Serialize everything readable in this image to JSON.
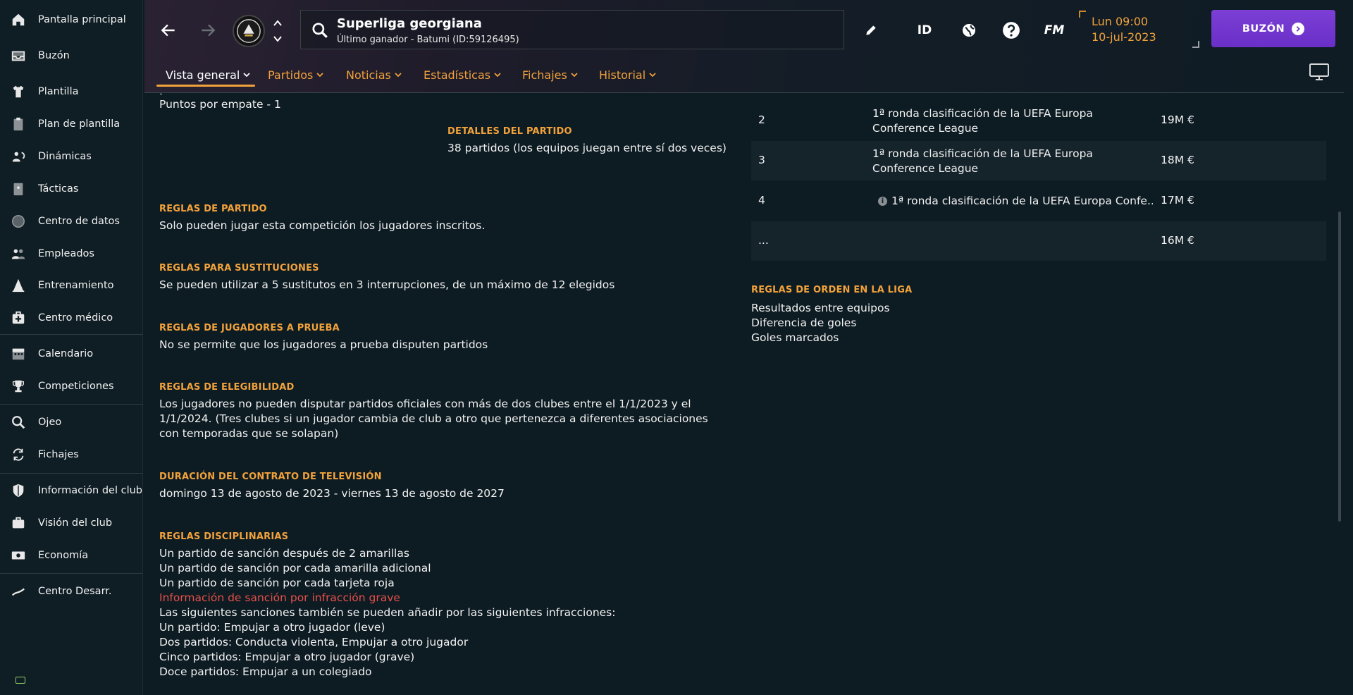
{
  "sidebar": {
    "items": [
      {
        "label": "Pantalla principal",
        "icon": "home-icon"
      },
      {
        "label": "Buzón",
        "icon": "inbox-icon"
      },
      {
        "label": "Plantilla",
        "icon": "shirt-icon"
      },
      {
        "label": "Plan de plantilla",
        "icon": "clipboard-icon"
      },
      {
        "label": "Dinámicas",
        "icon": "dynamics-icon"
      },
      {
        "label": "Tácticas",
        "icon": "tactics-board-icon"
      },
      {
        "label": "Centro de datos",
        "icon": "data-hub-icon"
      },
      {
        "label": "Empleados",
        "icon": "staff-icon"
      },
      {
        "label": "Entrenamiento",
        "icon": "training-cone-icon"
      },
      {
        "label": "Centro médico",
        "icon": "medical-kit-icon"
      },
      {
        "label": "Calendario",
        "icon": "calendar-icon"
      },
      {
        "label": "Competiciones",
        "icon": "trophy-icon"
      },
      {
        "label": "Ojeo",
        "icon": "magnifier-icon"
      },
      {
        "label": "Fichajes",
        "icon": "transfer-icon"
      },
      {
        "label": "Información del club",
        "icon": "shield-icon"
      },
      {
        "label": "Visión del club",
        "icon": "briefcase-icon"
      },
      {
        "label": "Economía",
        "icon": "money-icon"
      },
      {
        "label": "Centro Desarr.",
        "icon": "development-icon"
      }
    ]
  },
  "header": {
    "search_title": "Superliga georgiana",
    "search_subtitle": "Último ganador - Batumi (ID:59126495)",
    "id_label": "ID",
    "fm_label": "FM",
    "time": "Lun 09:00",
    "date": "10-jul-2023",
    "inbox_label": "BUZÓN"
  },
  "tabs": [
    {
      "label": "Vista general",
      "active": true
    },
    {
      "label": "Partidos",
      "active": false
    },
    {
      "label": "Noticias",
      "active": false
    },
    {
      "label": "Estadísticas",
      "active": false
    },
    {
      "label": "Fichajes",
      "active": false
    },
    {
      "label": "Historial",
      "active": false
    }
  ],
  "rules": {
    "points_draw": "Puntos por empate - 1",
    "match_details": {
      "heading": "DETALLES DEL PARTIDO",
      "text": "38 partidos (los equipos juegan entre sí dos veces)"
    },
    "match_rules": {
      "heading": "REGLAS DE PARTIDO",
      "text": "Solo pueden jugar esta competición los jugadores inscritos."
    },
    "substitution_rules": {
      "heading": "REGLAS PARA SUSTITUCIONES",
      "text": "Se pueden utilizar a 5 sustitutos en 3 interrupciones, de un máximo de 12 elegidos"
    },
    "trial_rules": {
      "heading": "REGLAS DE JUGADORES A PRUEBA",
      "text": "No se permite que los jugadores a prueba disputen partidos"
    },
    "eligibility_rules": {
      "heading": "REGLAS DE ELEGIBILIDAD",
      "text": "Los jugadores no pueden disputar partidos oficiales con más de dos clubes entre el 1/1/2023 y el 1/1/2024. (Tres clubes si un jugador cambia de club a otro que pertenezca a diferentes asociaciones con temporadas que se solapan)"
    },
    "tv_contract": {
      "heading": "DURACIÓN DEL CONTRATO DE TELEVISIÓN",
      "text": "domingo 13 de agosto de 2023 - viernes 13 de agosto de 2027"
    },
    "disciplinary": {
      "heading": "REGLAS DISCIPLINARIAS",
      "line1": "Un partido de sanción después de 2 amarillas",
      "line2": "Un partido de sanción por cada amarilla adicional",
      "line3": "Un partido de sanción por cada tarjeta roja",
      "serious_info": "Información de sanción por infracción grave",
      "line4": "Las siguientes sanciones también se pueden añadir por las siguientes infracciones:",
      "line5": "Un partido: Empujar a otro jugador (leve)",
      "line6": "Dos partidos: Conducta violenta, Empujar a otro jugador",
      "line7": "Cinco partidos: Empujar a otro jugador (grave)",
      "line8": "Doce partidos: Empujar a un colegiado"
    }
  },
  "prizes": [
    {
      "pos": "2",
      "comp": "1ª ronda clasificación de la UEFA Europa Conference League",
      "money": "19M €"
    },
    {
      "pos": "3",
      "comp": "1ª ronda clasificación de la UEFA Europa Conference League",
      "money": "18M €"
    },
    {
      "pos": "4",
      "comp": "1ª ronda clasificación de la UEFA Europa Confe...",
      "money": "17M €"
    },
    {
      "pos": "...",
      "comp": "",
      "money": "16M €"
    }
  ],
  "tiebreak": {
    "heading": "REGLAS DE ORDEN EN LA LIGA",
    "items": [
      "Resultados entre equipos",
      "Diferencia de goles",
      "Goles marcados"
    ]
  },
  "colors": {
    "accent": "#f2a23b",
    "background": "#0d1b22",
    "inbox_button": "#7b3fd6",
    "warning_text": "#e6504a"
  }
}
